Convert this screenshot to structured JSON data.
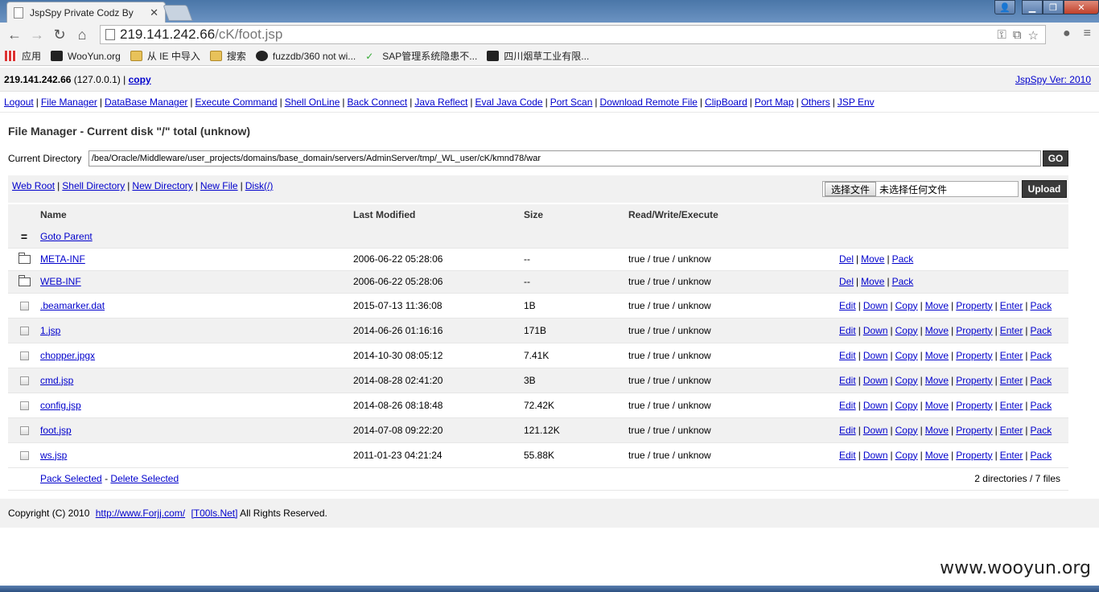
{
  "browser": {
    "tab_title": "JspSpy Private Codz By",
    "url_host": "219.141.242.66",
    "url_path": "/cK/foot.jsp",
    "bookmarks": [
      {
        "label": "应用",
        "icon": "apps-icon"
      },
      {
        "label": "WooYun.org",
        "icon": "wooyun-icon"
      },
      {
        "label": "从 IE 中导入",
        "icon": "folder-icon"
      },
      {
        "label": "搜索",
        "icon": "folder-icon"
      },
      {
        "label": "fuzzdb/360 not wi...",
        "icon": "github-icon"
      },
      {
        "label": "SAP管理系统隐患不...",
        "icon": "sap-icon"
      },
      {
        "label": "四川烟草工业有限...",
        "icon": "wooyun-icon"
      }
    ]
  },
  "header": {
    "host": "219.141.242.66",
    "local_ip": "(127.0.0.1)",
    "sep": "|",
    "copy_link": "copy",
    "version": "JspSpy Ver: 2010"
  },
  "menu": [
    "Logout",
    "File Manager",
    "DataBase Manager",
    "Execute Command",
    "Shell OnLine",
    "Back Connect",
    "Java Reflect",
    "Eval Java Code",
    "Port Scan",
    "Download Remote File",
    "ClipBoard",
    "Port Map",
    "Others",
    "JSP Env"
  ],
  "file_manager": {
    "title": "File Manager - Current disk \"/\" total (unknow)",
    "current_dir_label": "Current Directory",
    "current_dir": "/bea/Oracle/Middleware/user_projects/domains/base_domain/servers/AdminServer/tmp/_WL_user/cK/kmnd78/war",
    "go_label": "GO",
    "actions": [
      "Web Root",
      "Shell Directory",
      "New Directory",
      "New File",
      "Disk(/)"
    ],
    "choose_file_label": "选择文件",
    "no_file_label": "未选择任何文件",
    "upload_label": "Upload",
    "columns": [
      "Name",
      "Last Modified",
      "Size",
      "Read/Write/Execute"
    ],
    "goto_parent": "Goto Parent",
    "goto_parent_marker": "=",
    "dir_ops": [
      "Del",
      "Move",
      "Pack"
    ],
    "file_ops": [
      "Edit",
      "Down",
      "Copy",
      "Move",
      "Property",
      "Enter",
      "Pack"
    ],
    "directories": [
      {
        "name": "META-INF",
        "modified": "2006-06-22 05:28:06",
        "size": "--",
        "rwx": "true / true / unknow"
      },
      {
        "name": "WEB-INF",
        "modified": "2006-06-22 05:28:06",
        "size": "--",
        "rwx": "true / true / unknow"
      }
    ],
    "files": [
      {
        "name": ".beamarker.dat",
        "modified": "2015-07-13 11:36:08",
        "size": "1B",
        "rwx": "true / true / unknow"
      },
      {
        "name": "1.jsp",
        "modified": "2014-06-26 01:16:16",
        "size": "171B",
        "rwx": "true / true / unknow"
      },
      {
        "name": "chopper.jpgx",
        "modified": "2014-10-30 08:05:12",
        "size": "7.41K",
        "rwx": "true / true / unknow"
      },
      {
        "name": "cmd.jsp",
        "modified": "2014-08-28 02:41:20",
        "size": "3B",
        "rwx": "true / true / unknow"
      },
      {
        "name": "config.jsp",
        "modified": "2014-08-26 08:18:48",
        "size": "72.42K",
        "rwx": "true / true / unknow"
      },
      {
        "name": "foot.jsp",
        "modified": "2014-07-08 09:22:20",
        "size": "121.12K",
        "rwx": "true / true / unknow"
      },
      {
        "name": "ws.jsp",
        "modified": "2011-01-23 04:21:24",
        "size": "55.88K",
        "rwx": "true / true / unknow"
      }
    ],
    "pack_selected": "Pack Selected",
    "dash": "-",
    "delete_selected": "Delete Selected",
    "summary": "2 directories / 7 files"
  },
  "footer": {
    "prefix": "Copyright (C) 2010",
    "link1": "http://www.Forjj.com/",
    "link2": "[T00ls.Net]",
    "suffix": "All Rights Reserved."
  },
  "watermark": "www.wooyun.org"
}
